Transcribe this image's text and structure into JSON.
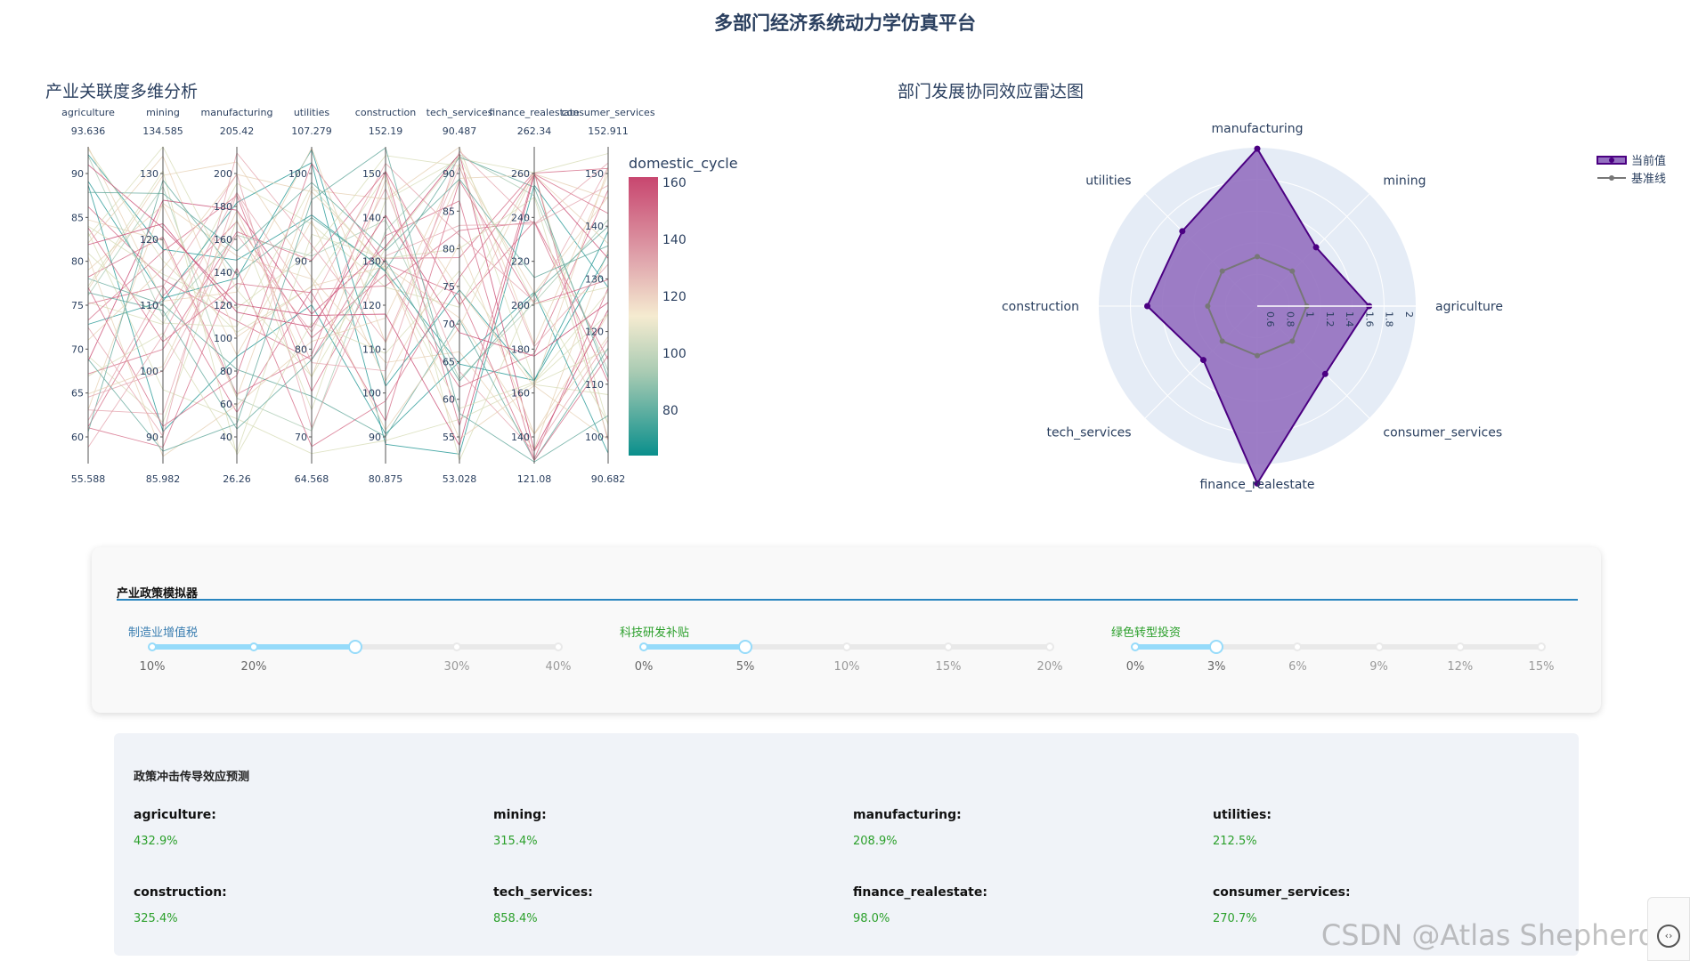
{
  "header": {
    "title": "多部门经济系统动力学仿真平台"
  },
  "parcoords": {
    "title": "产业关联度多维分析",
    "colorbar_title": "domestic_cycle",
    "colorbar_ticks": [
      "160",
      "140",
      "120",
      "100",
      "80"
    ],
    "dimensions": [
      {
        "name": "agriculture",
        "max": "93.636",
        "min": "55.588",
        "ticks": [
          "90",
          "85",
          "80",
          "75",
          "70",
          "65",
          "60"
        ]
      },
      {
        "name": "mining",
        "max": "134.585",
        "min": "85.982",
        "ticks": [
          "130",
          "120",
          "110",
          "100",
          "90"
        ]
      },
      {
        "name": "manufacturing",
        "max": "205.42",
        "min": "26.26",
        "ticks": [
          "200",
          "180",
          "160",
          "140",
          "120",
          "100",
          "80",
          "60",
          "40"
        ]
      },
      {
        "name": "utilities",
        "max": "107.279",
        "min": "64.568",
        "ticks": [
          "100",
          "90",
          "80",
          "70"
        ]
      },
      {
        "name": "construction",
        "max": "152.19",
        "min": "80.875",
        "ticks": [
          "150",
          "140",
          "130",
          "120",
          "110",
          "100",
          "90"
        ]
      },
      {
        "name": "tech_services",
        "max": "90.487",
        "min": "53.028",
        "ticks": [
          "90",
          "85",
          "80",
          "75",
          "70",
          "65",
          "60",
          "55"
        ]
      },
      {
        "name": "finance_realestate",
        "max": "262.34",
        "min": "121.08",
        "ticks": [
          "260",
          "240",
          "220",
          "200",
          "180",
          "160",
          "140"
        ]
      },
      {
        "name": "consumer_services",
        "max": "152.911",
        "min": "90.682",
        "ticks": [
          "150",
          "140",
          "130",
          "120",
          "110",
          "100"
        ]
      }
    ]
  },
  "radar": {
    "title": "部门发展协同效应雷达图",
    "axes": [
      "manufacturing",
      "mining",
      "agriculture",
      "consumer_services",
      "finance_realestate",
      "tech_services",
      "construction",
      "utilities"
    ],
    "radial_ticks": [
      "0.6",
      "0.8",
      "1",
      "1.2",
      "1.4",
      "1.6",
      "1.8",
      "2"
    ],
    "legend": {
      "current": "当前值",
      "baseline": "基准线"
    },
    "colors": {
      "current": "#4b0082",
      "fill": "#9370c0",
      "baseline": "#777777",
      "bg": "#e5ecf6"
    }
  },
  "chart_data": [
    {
      "type": "radar",
      "categories": [
        "manufacturing",
        "mining",
        "agriculture",
        "consumer_services",
        "finance_realestate",
        "tech_services",
        "construction",
        "utilities"
      ],
      "series": [
        {
          "name": "当前值",
          "values": [
            2.09,
            1.34,
            1.63,
            1.47,
            2.43,
            1.27,
            1.61,
            1.57
          ]
        },
        {
          "name": "基准线",
          "values": [
            1.0,
            1.0,
            1.0,
            1.0,
            1.0,
            1.0,
            1.0,
            1.0
          ]
        }
      ],
      "radial_range": [
        0.5,
        2.1
      ]
    }
  ],
  "policy": {
    "title": "产业政策模拟器",
    "sliders": [
      {
        "label": "制造业增值税",
        "ticks": [
          "10%",
          "20%",
          "30%",
          "40%"
        ],
        "value_fraction": 0.5,
        "color": "#3c7fb1"
      },
      {
        "label": "科技研发补贴",
        "ticks": [
          "0%",
          "5%",
          "10%",
          "15%",
          "20%"
        ],
        "value_fraction": 0.25,
        "color": "#2ca02c"
      },
      {
        "label": "绿色转型投资",
        "ticks": [
          "0%",
          "3%",
          "6%",
          "9%",
          "12%",
          "15%"
        ],
        "value_fraction": 0.2,
        "color": "#2ca02c"
      }
    ]
  },
  "predictions": {
    "title": "政策冲击传导效应预测",
    "items": [
      {
        "name": "agriculture:",
        "value": "432.9%"
      },
      {
        "name": "mining:",
        "value": "315.4%"
      },
      {
        "name": "manufacturing:",
        "value": "208.9%"
      },
      {
        "name": "utilities:",
        "value": "212.5%"
      },
      {
        "name": "construction:",
        "value": "325.4%"
      },
      {
        "name": "tech_services:",
        "value": "858.4%"
      },
      {
        "name": "finance_realestate:",
        "value": "98.0%"
      },
      {
        "name": "consumer_services:",
        "value": "270.7%"
      }
    ]
  },
  "watermark": "CSDN @Atlas Shepherd"
}
